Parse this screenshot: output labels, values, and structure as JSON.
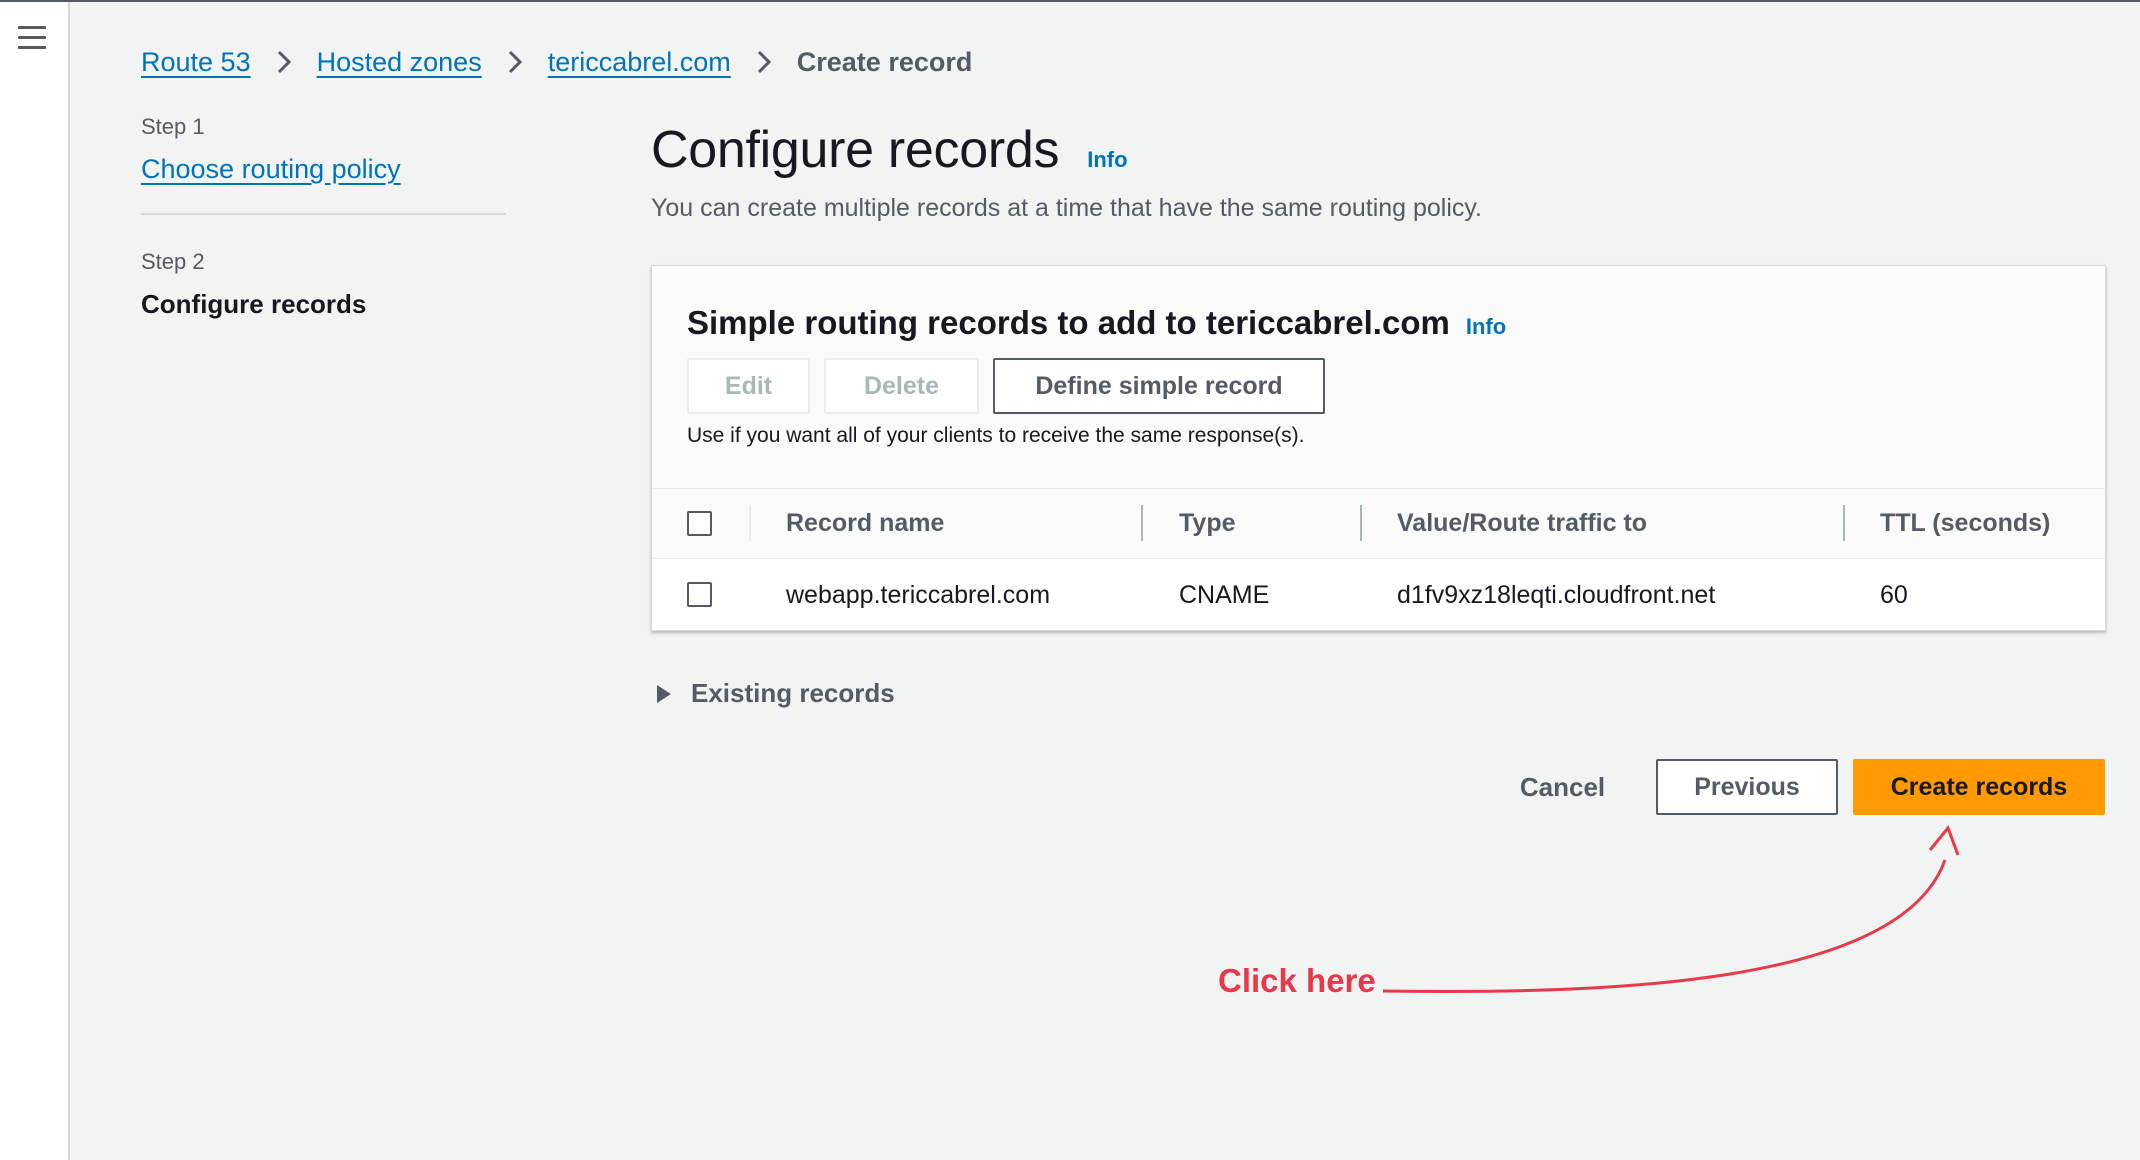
{
  "breadcrumb": {
    "items": [
      "Route 53",
      "Hosted zones",
      "tericcabrel.com"
    ],
    "current": "Create record"
  },
  "steps": {
    "step1_label": "Step 1",
    "step1_title": "Choose routing policy",
    "step2_label": "Step 2",
    "step2_title": "Configure records"
  },
  "main": {
    "title": "Configure records",
    "info": "Info",
    "description": "You can create multiple records at a time that have the same routing policy."
  },
  "panel": {
    "title": "Simple routing records to add to tericcabrel.com",
    "info": "Info",
    "buttons": {
      "edit": "Edit",
      "delete": "Delete",
      "define": "Define simple record"
    },
    "hint": "Use if you want all of your clients to receive the same response(s).",
    "columns": [
      "Record name",
      "Type",
      "Value/Route traffic to",
      "TTL (seconds)"
    ],
    "rows": [
      {
        "record_name": "webapp.tericcabrel.com",
        "type": "CNAME",
        "value": "d1fv9xz18leqti.cloudfront.net",
        "ttl": "60"
      }
    ]
  },
  "existing_records": "Existing records",
  "actions": {
    "cancel": "Cancel",
    "previous": "Previous",
    "create": "Create records"
  },
  "annotation": {
    "text": "Click here",
    "color": "#e8394a"
  },
  "colors": {
    "accent": "#ff9900",
    "link": "#0073bb",
    "background": "#f2f3f3"
  },
  "icons": [
    "menu-icon",
    "chevron-right-icon",
    "caret-right-icon",
    "checkbox-icon",
    "arrow-icon"
  ]
}
